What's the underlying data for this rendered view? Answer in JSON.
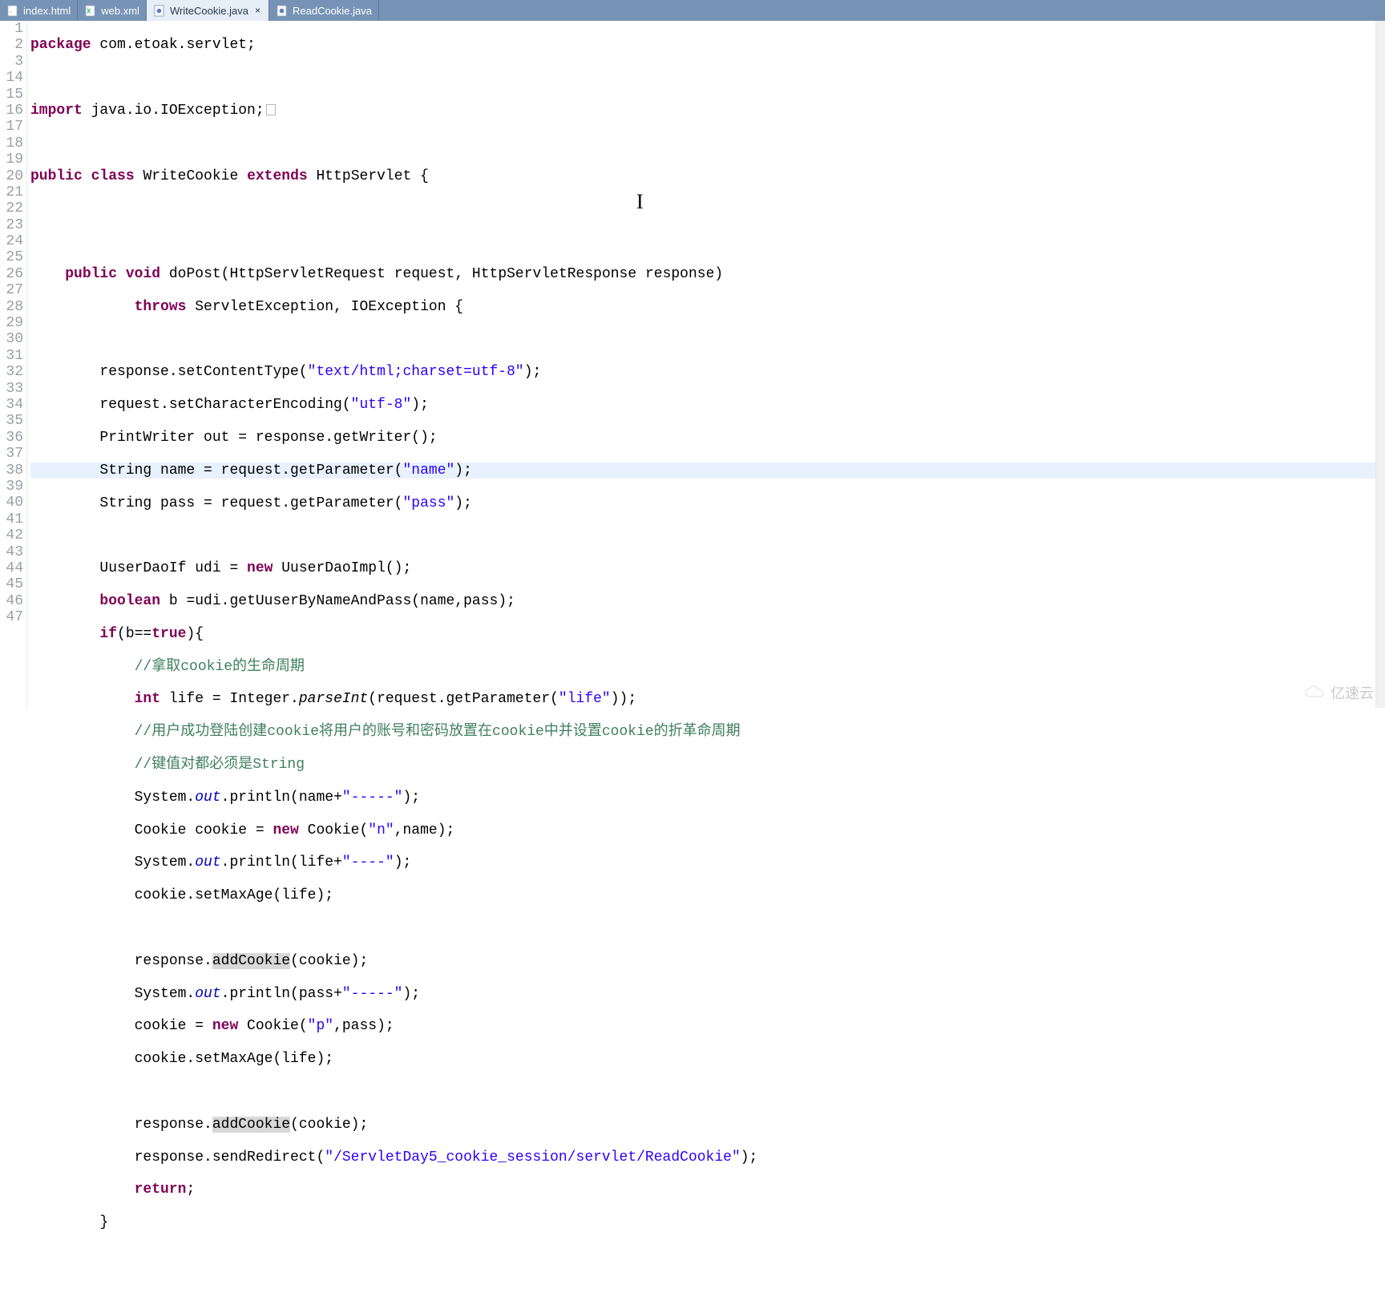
{
  "tabs": [
    {
      "label": "index.html",
      "icon": "html-file-icon",
      "active": false
    },
    {
      "label": "web.xml",
      "icon": "xml-file-icon",
      "active": false
    },
    {
      "label": "WriteCookie.java",
      "icon": "java-file-icon",
      "active": true,
      "closable": true
    },
    {
      "label": "ReadCookie.java",
      "icon": "java-file-icon",
      "active": false
    }
  ],
  "line_numbers": [
    "1",
    "2",
    "3",
    "14",
    "15",
    "16",
    "17",
    "18",
    "19",
    "20",
    "21",
    "22",
    "23",
    "24",
    "25",
    "26",
    "27",
    "28",
    "29",
    "30",
    "31",
    "32",
    "33",
    "34",
    "35",
    "36",
    "37",
    "38",
    "39",
    "40",
    "41",
    "42",
    "43",
    "44",
    "45",
    "46",
    "47"
  ],
  "kw": {
    "package": "package",
    "import": "import",
    "public": "public",
    "class": "class",
    "extends": "extends",
    "void": "void",
    "throws": "throws",
    "new": "new",
    "boolean": "boolean",
    "if": "if",
    "true": "true",
    "int": "int",
    "return": "return"
  },
  "t": {
    "pkg_name": " com.etoak.servlet;",
    "import_stmt": " java.io.IOException;",
    "class_sp": " ",
    "class_name": " WriteCookie ",
    "class_tail": " HttpServlet {",
    "method_sig": " doPost(HttpServletRequest request, HttpServletResponse response)",
    "throws_tail": " ServletException, IOException {",
    "l21_a": "        response.setContentType(",
    "l21_s": "\"text/html;charset=utf-8\"",
    "l21_b": ");",
    "l22_a": "        request.setCharacterEncoding(",
    "l22_s": "\"utf-8\"",
    "l22_b": ");",
    "l23": "        PrintWriter out = response.getWriter();",
    "l24_a": "        String name = request.getParameter(",
    "l24_s": "\"name\"",
    "l24_b": ");",
    "l25_a": "        String pass = request.getParameter(",
    "l25_s": "\"pass\"",
    "l25_b": ");",
    "l27_a": "        UuserDaoIf udi = ",
    "l27_b": " UuserDaoImpl();",
    "l28_a": "        ",
    "l28_b": " b =udi.getUuserByNameAndPass(name,pass);",
    "l29_a": "        ",
    "l29_b": "(b==",
    "l29_c": "){",
    "cm30": "            //拿取cookie的生命周期",
    "l31_a": "            ",
    "l31_b": " life = Integer.",
    "l31_c": "parseInt",
    "l31_d": "(request.getParameter(",
    "l31_s": "\"life\"",
    "l31_e": "));",
    "cm32": "            //用户成功登陆创建cookie将用户的账号和密码放置在cookie中并设置cookie的折革命周期",
    "cm33": "            //键值对都必须是String",
    "l34_a": "            System.",
    "l34_out": "out",
    "l34_b": ".println(name+",
    "l34_s": "\"-----\"",
    "l34_c": ");",
    "l35_a": "            Cookie cookie = ",
    "l35_b": " Cookie(",
    "l35_s": "\"n\"",
    "l35_c": ",name);",
    "l36_a": "            System.",
    "l36_b": ".println(life+",
    "l36_s": "\"----\"",
    "l36_c": ");",
    "l37": "            cookie.setMaxAge(life);",
    "l39_a": "            response.",
    "addCookie": "addCookie",
    "l39_b": "(cookie);",
    "l40_a": "            System.",
    "l40_b": ".println(pass+",
    "l40_s": "\"-----\"",
    "l40_c": ");",
    "l41_a": "            cookie = ",
    "l41_b": " Cookie(",
    "l41_s": "\"p\"",
    "l41_c": ",pass);",
    "l42": "            cookie.setMaxAge(life);",
    "l44_a": "            response.",
    "l44_b": "(cookie);",
    "l45_a": "            response.sendRedirect(",
    "l45_s": "\"/ServletDay5_cookie_session/servlet/ReadCookie\"",
    "l45_b": ");",
    "l46_a": "            ",
    "l46_b": ";",
    "l47": "        }"
  },
  "watermark": "亿速云",
  "highlighted_line_index": 13
}
